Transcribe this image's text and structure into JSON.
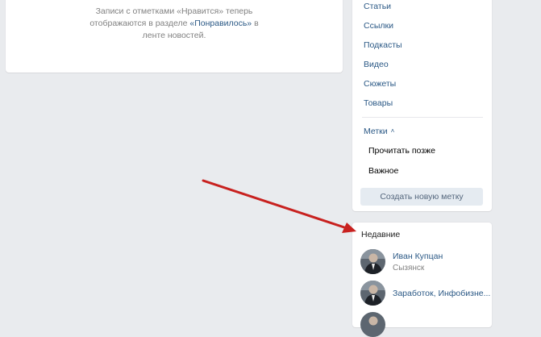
{
  "likes_notice": {
    "line1": "Записи с отметками «Нравится» теперь",
    "line2_before": "отображаются в разделе ",
    "line2_link": "«Понравилось»",
    "line2_after": " в",
    "line3": "ленте новостей."
  },
  "menu": {
    "items": [
      {
        "label": "Статьи"
      },
      {
        "label": "Ссылки"
      },
      {
        "label": "Подкасты"
      },
      {
        "label": "Видео"
      },
      {
        "label": "Сюжеты"
      },
      {
        "label": "Товары"
      }
    ],
    "tags_label": "Метки",
    "tags": [
      {
        "label": "Прочитать позже"
      },
      {
        "label": "Важное"
      }
    ],
    "create_tag_label": "Создать новую метку"
  },
  "recent": {
    "title": "Недавние",
    "people": [
      {
        "name": "Иван Купцан",
        "subtitle": "Сызянск"
      },
      {
        "name": "Заработок, Инфобизне...",
        "subtitle": ""
      }
    ]
  },
  "colors": {
    "background": "#e9ebee",
    "link": "#2a5885",
    "arrow": "#c8211f"
  }
}
